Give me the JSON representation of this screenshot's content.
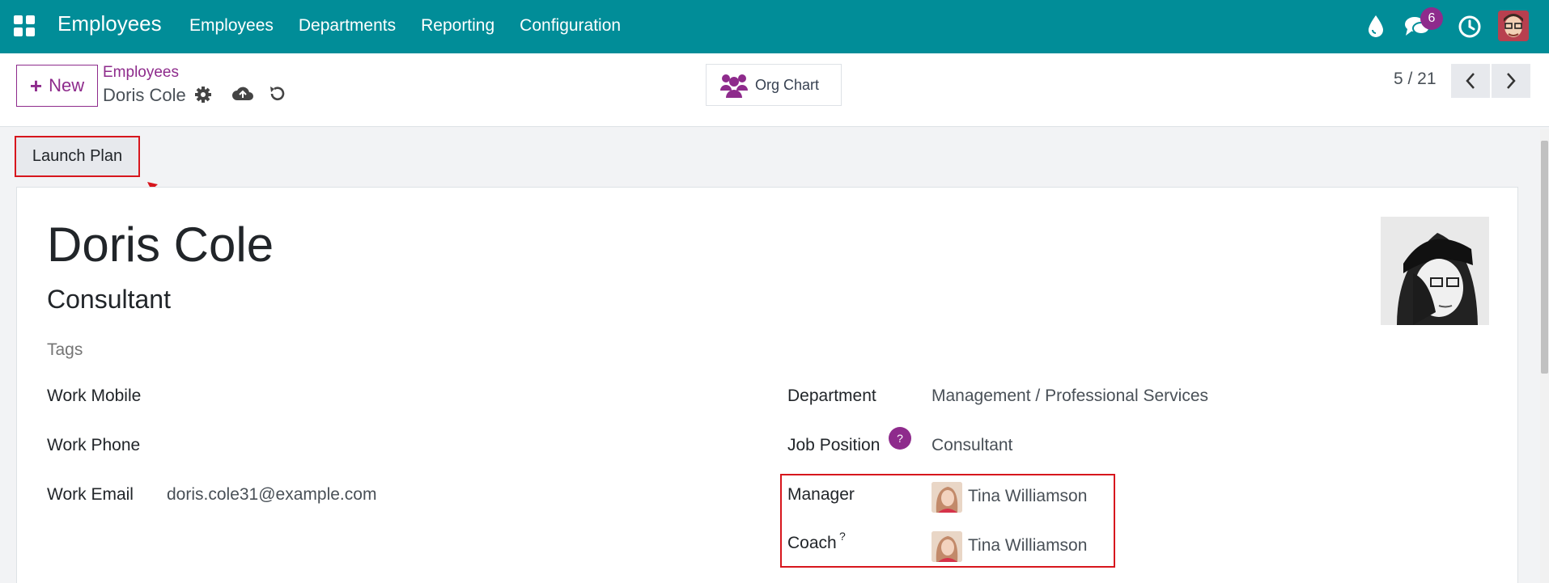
{
  "navbar": {
    "brand": "Employees",
    "menu": [
      "Employees",
      "Departments",
      "Reporting",
      "Configuration"
    ],
    "chat_badge": "6",
    "icons": [
      "apps-grid-icon",
      "drop-icon",
      "chat-icon",
      "clock-icon",
      "user-avatar"
    ]
  },
  "control": {
    "new_label": "New",
    "breadcrumb_parent": "Employees",
    "breadcrumb_current": "Doris Cole",
    "org_chart_label": "Org Chart",
    "pager": "5 / 21"
  },
  "status": {
    "launch_plan_label": "Launch Plan"
  },
  "employee": {
    "name": "Doris Cole",
    "job_title": "Consultant",
    "tags_placeholder": "Tags",
    "fields_left": {
      "work_mobile_label": "Work Mobile",
      "work_phone_label": "Work Phone",
      "work_email_label": "Work Email",
      "work_email_value": "doris.cole31@example.com"
    },
    "fields_right": {
      "department_label": "Department",
      "department_value": "Management / Professional Services",
      "job_position_label": "Job Position",
      "job_position_help": "?",
      "job_position_value": "Consultant",
      "manager_label": "Manager",
      "manager_value": "Tina Williamson",
      "coach_label": "Coach",
      "coach_sup": "?",
      "coach_value": "Tina Williamson"
    }
  },
  "colors": {
    "navbar": "#018d98",
    "brand_purple": "#8e2b8c",
    "highlight_red": "#d7161d"
  }
}
